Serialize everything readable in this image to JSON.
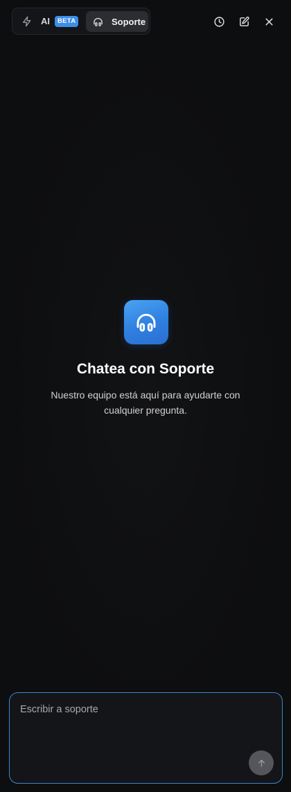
{
  "header": {
    "tabs": {
      "ai_label": "AI",
      "ai_badge": "BETA",
      "support_label": "Soporte"
    },
    "actions": [
      "history-icon",
      "new-chat-icon",
      "close-icon"
    ]
  },
  "empty_state": {
    "icon": "headphones-icon",
    "title": "Chatea con Soporte",
    "subtitle": "Nuestro equipo está aquí para ayudarte con cualquier pregunta."
  },
  "composer": {
    "value": "",
    "placeholder": "Escribir a soporte",
    "send_icon": "arrow-up-icon"
  },
  "colors": {
    "background": "#0f1012",
    "accent": "#3d8ee8",
    "active_tab": "#2c2d31",
    "composer_border": "#3b86d6"
  }
}
